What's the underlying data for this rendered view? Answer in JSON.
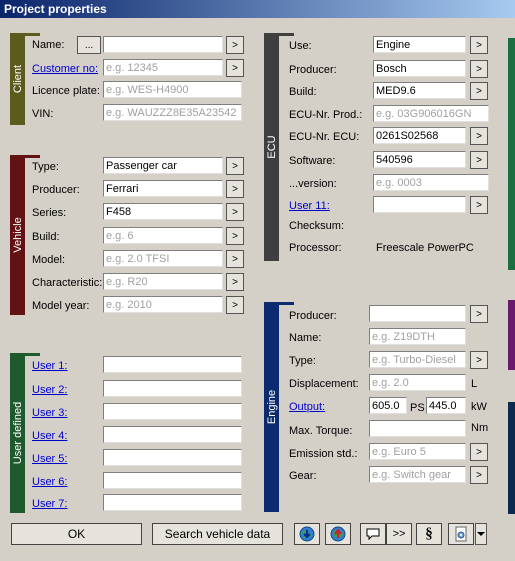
{
  "title": "Project properties",
  "colors": {
    "client": "#5b5b20",
    "vehicle": "#621213",
    "user": "#1f5a2e",
    "ecu": "#3f3f3f",
    "engine": "#0c2a6e",
    "right1": "#1a6e40",
    "right2": "#6a1a6e",
    "right3": "#0b2a4e"
  },
  "client": {
    "section": "Client",
    "name_label": "Name:",
    "name_value": "",
    "dots_label": "...",
    "customer_label": "Customer no:",
    "customer_placeholder": "e.g. 12345",
    "licence_label": "Licence plate:",
    "licence_placeholder": "e.g. WES-H4900",
    "vin_label": "VIN:",
    "vin_placeholder": "e.g. WAUZZZ8E35A23542"
  },
  "vehicle": {
    "section": "Vehicle",
    "type_label": "Type:",
    "type_value": "Passenger car",
    "producer_label": "Producer:",
    "producer_value": "Ferrari",
    "series_label": "Series:",
    "series_value": "F458",
    "build_label": "Build:",
    "build_placeholder": "e.g. 6",
    "model_label": "Model:",
    "model_placeholder": "e.g. 2.0 TFSI",
    "characteristic_label": "Characteristic:",
    "characteristic_placeholder": "e.g. R20",
    "modelyear_label": "Model year:",
    "modelyear_placeholder": "e.g. 2010"
  },
  "user": {
    "section": "User defined",
    "items": [
      "User 1:",
      "User 2:",
      "User 3:",
      "User 4:",
      "User 5:",
      "User 6:",
      "User 7:"
    ]
  },
  "ecu": {
    "section": "ECU",
    "use_label": "Use:",
    "use_value": "Engine",
    "producer_label": "Producer:",
    "producer_value": "Bosch",
    "build_label": "Build:",
    "build_value": "MED9.6",
    "prod_label": "ECU-Nr. Prod.:",
    "prod_placeholder": "e.g. 03G906016GN",
    "ecunr_label": "ECU-Nr. ECU:",
    "ecunr_value": "0261S02568",
    "software_label": "Software:",
    "software_value": "540596",
    "version_label": "...version:",
    "version_placeholder": "e.g. 0003",
    "user11_label": "User 11:",
    "user11_value": "",
    "checksum_label": "Checksum:",
    "processor_label": "Processor:",
    "processor_value": "Freescale PowerPC"
  },
  "engine": {
    "section": "Engine",
    "producer_label": "Producer:",
    "producer_value": "",
    "name_label": "Name:",
    "name_placeholder": "e.g. Z19DTH",
    "type_label": "Type:",
    "type_placeholder": "e.g. Turbo-Diesel",
    "displacement_label": "Displacement:",
    "displacement_placeholder": "e.g. 2.0",
    "displacement_unit": "L",
    "output_label": "Output:",
    "output_ps": "605.0",
    "ps_unit": "PS",
    "output_kw": "445.0",
    "kw_unit": "kW",
    "torque_label": "Max. Torque:",
    "torque_unit": "Nm",
    "emission_label": "Emission std.:",
    "emission_placeholder": "e.g. Euro 5",
    "gear_label": "Gear:",
    "gear_placeholder": "e.g. Switch gear"
  },
  "arrow": ">",
  "bottom": {
    "ok": "OK",
    "search": "Search vehicle data",
    "forward": ">>",
    "section_sign": "§"
  }
}
